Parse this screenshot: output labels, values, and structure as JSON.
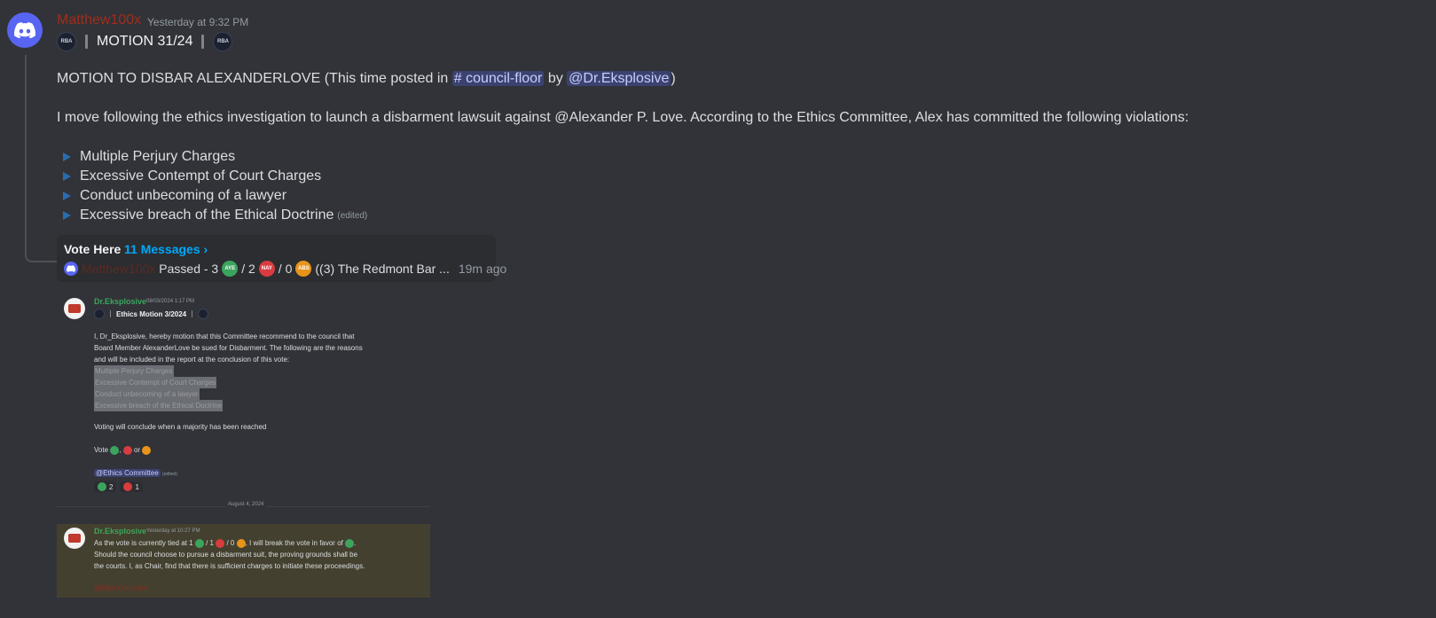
{
  "message": {
    "username": "Matthew100x",
    "timestamp": "Yesterday at 9:32 PM",
    "title": "MOTION 31/24",
    "emoji_label": "RBA",
    "line1_prefix": "MOTION TO DISBAR ALEXANDERLOVE (This time posted in ",
    "channel": "# council-floor",
    "line1_mid": " by ",
    "mention": "@Dr.Eksplosive",
    "line1_suffix": ")",
    "line2": "I move following the ethics investigation to launch a disbarment lawsuit against @Alexander P. Love. According to the Ethics Committee, Alex has committed the following violations:",
    "bullets": [
      "Multiple Perjury Charges",
      "Excessive Contempt of Court Charges",
      "Conduct unbecoming of a lawyer",
      "Excessive breach of the Ethical Doctrine"
    ],
    "edited": "(edited)"
  },
  "thread": {
    "title": "Vote Here",
    "count": "11 Messages ›",
    "author": "Matthew100x",
    "status_prefix": "Passed - 3",
    "sep1": "/ 2",
    "sep2": "/ 0",
    "status_suffix": "((3) The Redmont Bar ...",
    "age": "19m ago",
    "emoji": {
      "aye": "AYE",
      "nay": "NAY",
      "abs": "ABS"
    }
  },
  "embedded": {
    "msg1": {
      "username": "Dr.Eksplosive",
      "timestamp": "08/03/2024 1:17 PM",
      "title": "Ethics Motion 3/2024",
      "body1": "I, Dr_Eksplosive, hereby motion that this Committee recommend to the council that",
      "body2": "Board Member AlexanderLove be sued for Disbarment. The following are the reasons",
      "body3": "and will be included in the report at the conclusion of this vote:",
      "items": [
        "Multiple Perjury Charges",
        "Excessive Contempt of Court Charges",
        "Conduct unbecoming of a lawyer",
        "Excessive breach of the Ethical Doctrine"
      ],
      "voting": "Voting will conclude when a majority has been reached",
      "vote_prefix": "Vote",
      "vote_comma": ",",
      "vote_or": "or",
      "role": "@Ethics Committee",
      "edited": "(edited)",
      "react_aye": "2",
      "react_nay": "1"
    },
    "divider": "August 4, 2024",
    "msg2": {
      "username": "Dr.Eksplosive",
      "timestamp": "Yesterday at 10:27 PM",
      "line1_prefix": "As the vote is currently tied at 1",
      "line1_s1": "/ 1",
      "line1_s2": "/ 0",
      "line1_mid": ", I will break the vote in favor of",
      "line1_end": ".",
      "line2": "Should the council choose to pursue a disbarment suit, the proving grounds shall be",
      "line3": "the courts. I, as Chair, find that there is sufficient charges to initiate these proceedings.",
      "role": "@RBA Councilor"
    }
  },
  "colors": {
    "background": "#313338",
    "username": "#a12d1c",
    "link": "#00a8fc",
    "aye": "#3ba55d",
    "nay": "#d83c3e",
    "abs": "#e8941a"
  }
}
